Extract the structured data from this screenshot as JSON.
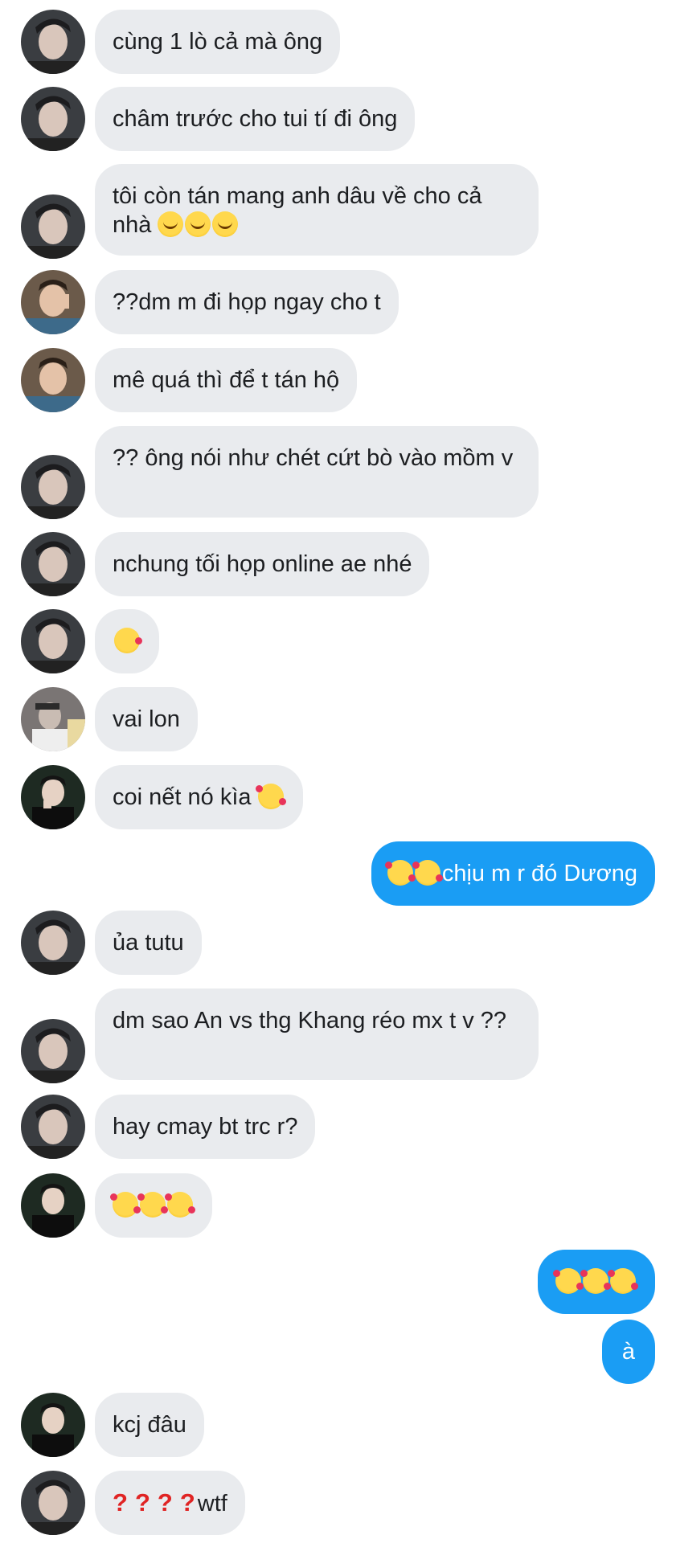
{
  "colors": {
    "incoming_bubble": "#e9ebee",
    "outgoing_bubble": "#1a9df4",
    "incoming_text": "#1c1e21",
    "outgoing_text": "#ffffff"
  },
  "messages": [
    {
      "sender": "A",
      "text": "cùng 1 lò cả mà ông"
    },
    {
      "sender": "A",
      "text": "châm trước cho tui tí đi ông"
    },
    {
      "sender": "A",
      "text": "tôi còn tán mang anh dâu về cho cả nhà",
      "emoji": [
        "smiling-face-emoji",
        "smiling-face-emoji",
        "smiling-face-emoji"
      ]
    },
    {
      "sender": "B",
      "text": "??dm m đi họp ngay cho t"
    },
    {
      "sender": "B",
      "text": "mê quá thì để t tán hộ"
    },
    {
      "sender": "A",
      "text": "?? ông nói như chét cứt bò vào mồm v"
    },
    {
      "sender": "A",
      "text": "nchung tối họp online ae nhé"
    },
    {
      "sender": "A",
      "text": "",
      "emoji": [
        "face-blowing-kiss-emoji"
      ]
    },
    {
      "sender": "C",
      "text": "vai lon"
    },
    {
      "sender": "D",
      "text": "coi nết nó kìa",
      "emoji": [
        "smiling-face-with-hearts-emoji"
      ]
    },
    {
      "sender": "me",
      "text": "chịu m r đó Dương",
      "emoji": [
        "smiling-face-with-hearts-emoji",
        "smiling-face-with-hearts-emoji"
      ]
    },
    {
      "sender": "A",
      "text": "ủa tutu"
    },
    {
      "sender": "A",
      "text": "dm sao An vs thg Khang réo mx t v ??"
    },
    {
      "sender": "A",
      "text": "hay cmay bt trc r?"
    },
    {
      "sender": "D",
      "text": "",
      "emoji": [
        "smiling-face-with-hearts-emoji",
        "smiling-face-with-hearts-emoji",
        "smiling-face-with-hearts-emoji"
      ]
    },
    {
      "sender": "me",
      "text": "",
      "emoji": [
        "smiling-face-with-hearts-emoji",
        "smiling-face-with-hearts-emoji",
        "smiling-face-with-hearts-emoji"
      ]
    },
    {
      "sender": "me",
      "text": "à"
    },
    {
      "sender": "D",
      "text": "kcj đâu"
    },
    {
      "sender": "A",
      "text": "wtf",
      "emoji": [
        "red-question-mark-emoji",
        "red-question-mark-emoji",
        "red-question-mark-emoji",
        "red-question-mark-emoji"
      ]
    }
  ],
  "emoji_glyphs": {
    "red_question": "?"
  }
}
